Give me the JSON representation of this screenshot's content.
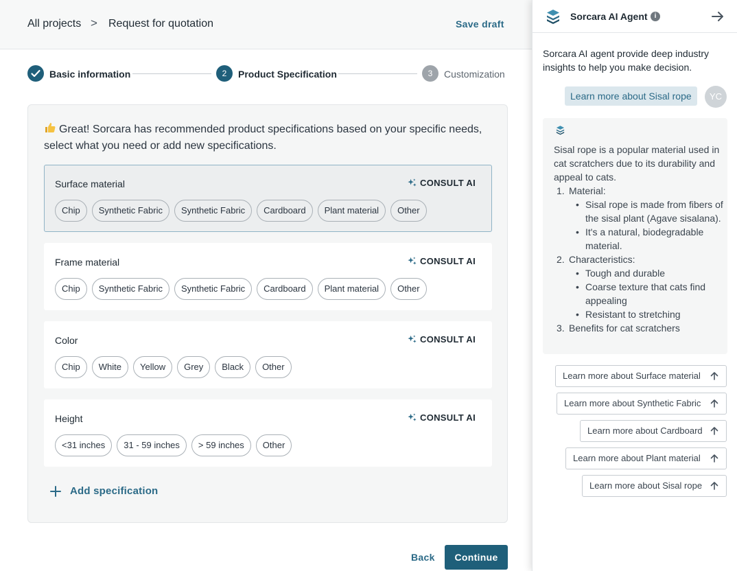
{
  "breadcrumb": {
    "root": "All projects",
    "separator": ">",
    "current": "Request for quotation"
  },
  "header": {
    "save_draft": "Save draft"
  },
  "stepper": {
    "steps": [
      {
        "number": "1",
        "label": "Basic information",
        "state": "done"
      },
      {
        "number": "2",
        "label": "Product Specification",
        "state": "active"
      },
      {
        "number": "3",
        "label": "Customization",
        "state": "upcoming"
      }
    ]
  },
  "intro": "Great! Sorcara has recommended product specifications based on your specific needs, select what you need or add new specifications.",
  "consult_label": "CONSULT AI",
  "specs": [
    {
      "title": "Surface material",
      "selected": true,
      "options": [
        "Chip",
        "Synthetic Fabric",
        "Synthetic Fabric",
        "Cardboard",
        "Plant material",
        "Other"
      ]
    },
    {
      "title": "Frame material",
      "selected": false,
      "options": [
        "Chip",
        "Synthetic Fabric",
        "Synthetic Fabric",
        "Cardboard",
        "Plant material",
        "Other"
      ]
    },
    {
      "title": "Color",
      "selected": false,
      "options": [
        "Chip",
        "White",
        "Yellow",
        "Grey",
        "Black",
        "Other"
      ]
    },
    {
      "title": "Height",
      "selected": false,
      "options": [
        "<31 inches",
        "31 - 59 inches",
        "> 59 inches",
        "Other"
      ]
    }
  ],
  "add_specification": "Add specification",
  "footer": {
    "back": "Back",
    "continue": "Continue"
  },
  "panel": {
    "title": "Sorcara AI Agent",
    "intro": "Sorcara AI agent provide deep industry insights to help you make decision.",
    "user_message": "Learn more about Sisal rope",
    "avatar_initials": "YC",
    "ai_response": {
      "summary": "Sisal rope is a popular material used in cat scratchers due to its durability and appeal to cats.",
      "sections": [
        {
          "num": "1.",
          "heading": "Material:",
          "bullets": [
            "Sisal rope is made from fibers of the sisal plant (Agave sisalana).",
            "It's a natural, biodegradable material."
          ]
        },
        {
          "num": "2.",
          "heading": "Characteristics:",
          "bullets": [
            "Tough and durable",
            "Coarse texture that cats find appealing",
            "Resistant to stretching"
          ]
        },
        {
          "num": "3.",
          "heading": "Benefits for cat scratchers",
          "bullets": []
        }
      ]
    },
    "suggestions": [
      "Learn more about Surface material",
      "Learn more about Synthetic Fabric",
      "Learn more about Cardboard",
      "Learn more about Plant material",
      "Learn more about Sisal rope"
    ]
  },
  "colors": {
    "primary": "#1f5f7a",
    "link": "#2b6a87",
    "selected_border": "#8fb3c6"
  },
  "icons": [
    "check-icon",
    "chevron-right-icon",
    "thumbs-up-icon",
    "sparkle-icon",
    "plus-icon",
    "sorcara-logo-icon",
    "info-icon",
    "arrow-right-icon",
    "arrow-up-icon"
  ]
}
